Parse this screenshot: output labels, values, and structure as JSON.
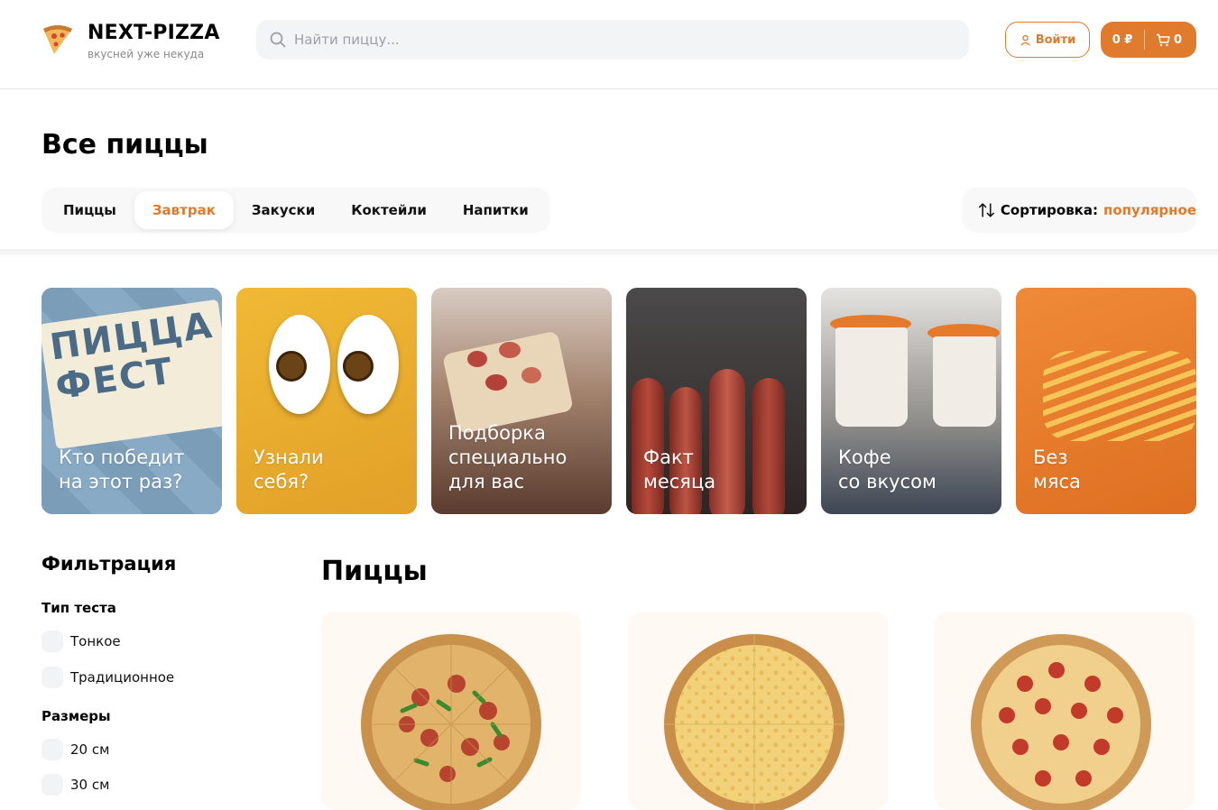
{
  "header": {
    "brand": "NEXT-PIZZA",
    "tagline": "вкусней уже некуда",
    "search_placeholder": "Найти пиццу...",
    "login_label": "Войти",
    "cart_sum": "0 ₽",
    "cart_count": "0",
    "accent": "#e07a2c"
  },
  "page": {
    "title": "Все пиццы"
  },
  "categories": [
    {
      "label": "Пиццы",
      "active": false
    },
    {
      "label": "Завтрак",
      "active": true
    },
    {
      "label": "Закуски",
      "active": false
    },
    {
      "label": "Коктейли",
      "active": false
    },
    {
      "label": "Напитки",
      "active": false
    }
  ],
  "sort": {
    "label": "Сортировка:",
    "value": "популярное"
  },
  "stories": [
    {
      "caption": "Кто победит\nна этот раз?",
      "badge": "ПИЦЦА\nФЕСТ",
      "bg": "#7fa2bd"
    },
    {
      "caption": "Узнали\nсебя?",
      "bg": "#e9aa2e"
    },
    {
      "caption": "Подборка\nспециально\nдля вас",
      "bg": "#8b7063"
    },
    {
      "caption": "Факт\nмесяца",
      "bg": "#7a2a22"
    },
    {
      "caption": "Кофе\nсо вкусом",
      "bg": "#6f7c8a"
    },
    {
      "caption": "Без\nмяса",
      "bg": "#e57a2a"
    }
  ],
  "filters": {
    "title": "Фильтрация",
    "dough": {
      "title": "Тип теста",
      "options": [
        "Тонкое",
        "Традиционное"
      ]
    },
    "sizes": {
      "title": "Размеры",
      "options": [
        "20 см",
        "30 см"
      ]
    }
  },
  "products": {
    "section_title": "Пиццы"
  }
}
